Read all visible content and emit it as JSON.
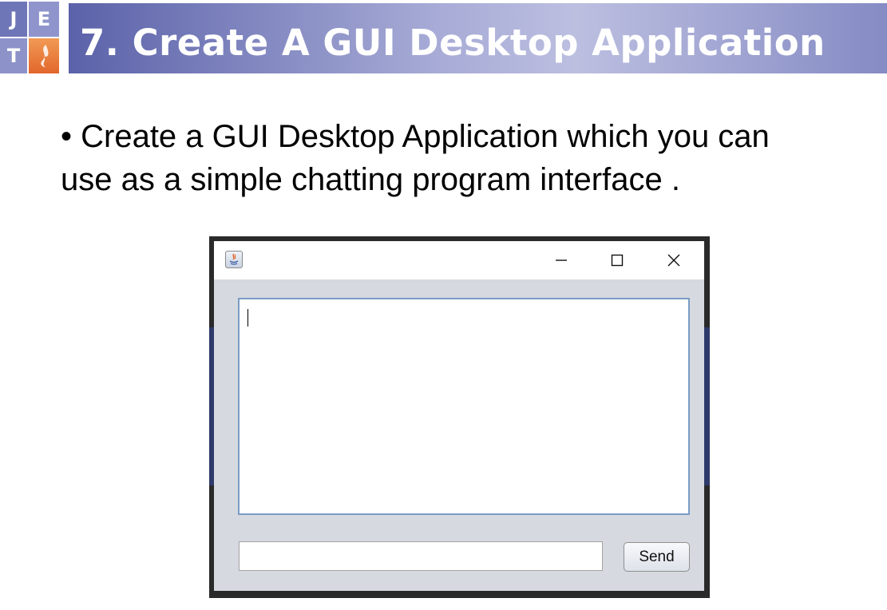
{
  "slide": {
    "logo_letters": {
      "top_left": "J",
      "top_right": "E",
      "bottom_left": "T"
    },
    "title": "7. Create A GUI Desktop Application",
    "bullet_line_1": "• Create a GUI Desktop Application which you can",
    "bullet_line_2": "use as a simple chatting program interface ."
  },
  "window": {
    "app_icon": "java-cup-icon",
    "controls": [
      "minimize-icon",
      "maximize-icon",
      "close-icon"
    ],
    "chat_area": {
      "value": ""
    },
    "message_input": {
      "value": "",
      "placeholder": ""
    },
    "send_label": "Send"
  },
  "colors": {
    "header_gradient_start": "#5b62a9",
    "header_gradient_mid": "#bcbfe0",
    "text_area_border": "#7a9cc6",
    "window_background": "#d6d9df"
  }
}
